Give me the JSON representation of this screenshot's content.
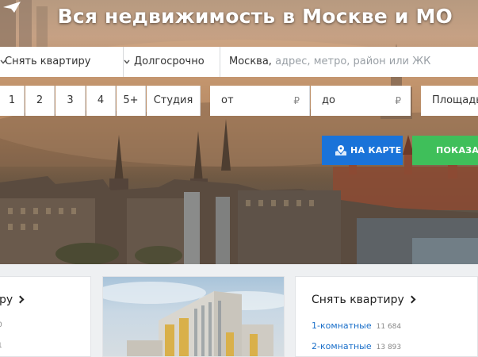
{
  "hero": {
    "title": "Вся недвижимость в Москве и МО"
  },
  "search": {
    "deal_type": "Снять квартиру",
    "term": "Долгосрочно",
    "address_value": "Москва,",
    "address_placeholder": "адрес, метро, район или ЖК",
    "rooms": [
      "1",
      "2",
      "3",
      "4",
      "5+",
      "Студия"
    ],
    "price_from": "от",
    "price_to": "до",
    "currency": "₽",
    "area": "Площадь"
  },
  "buttons": {
    "map": "НА КАРТЕ",
    "show": "ПОКАЗАТЬ"
  },
  "cards": {
    "left": {
      "title_fragment": "ру",
      "lines": [
        "0",
        "1"
      ]
    },
    "right": {
      "title": "Снять квартиру",
      "links": [
        {
          "label": "1-комнатные",
          "count": "11 684"
        },
        {
          "label": "2-комнатные",
          "count": "13 893"
        }
      ]
    }
  },
  "colors": {
    "accent_blue": "#1a73d9",
    "accent_green": "#3fbf5a",
    "link": "#1a6fc9"
  }
}
